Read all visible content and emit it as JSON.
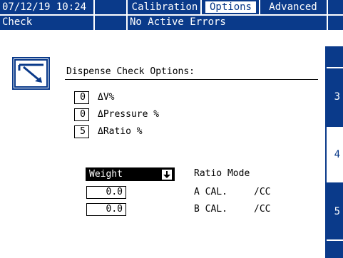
{
  "header": {
    "datetime": "07/12/19 10:24",
    "tabs": [
      {
        "label": "Calibration",
        "active": false
      },
      {
        "label": "Options",
        "active": true
      },
      {
        "label": "Advanced",
        "active": false
      }
    ],
    "mode": "Check",
    "status": "No Active Errors"
  },
  "icon": "dispense-check-icon",
  "section_title": "Dispense Check Options:",
  "options": [
    {
      "value": "0",
      "label": "ΔV%"
    },
    {
      "value": "0",
      "label": "ΔPressure %"
    },
    {
      "value": "5",
      "label": "ΔRatio %"
    }
  ],
  "ratio": {
    "mode_value": "Weight",
    "mode_label": "Ratio Mode",
    "a_value": "0.0",
    "a_label": "A CAL.",
    "a_unit": "/CC",
    "b_value": "0.0",
    "b_label": "B CAL.",
    "b_unit": "/CC"
  },
  "side_tabs": [
    "3",
    "4",
    "5"
  ],
  "active_side_tab": "4",
  "colors": {
    "bar": "#0a3a8a",
    "background": "#ffffff"
  }
}
